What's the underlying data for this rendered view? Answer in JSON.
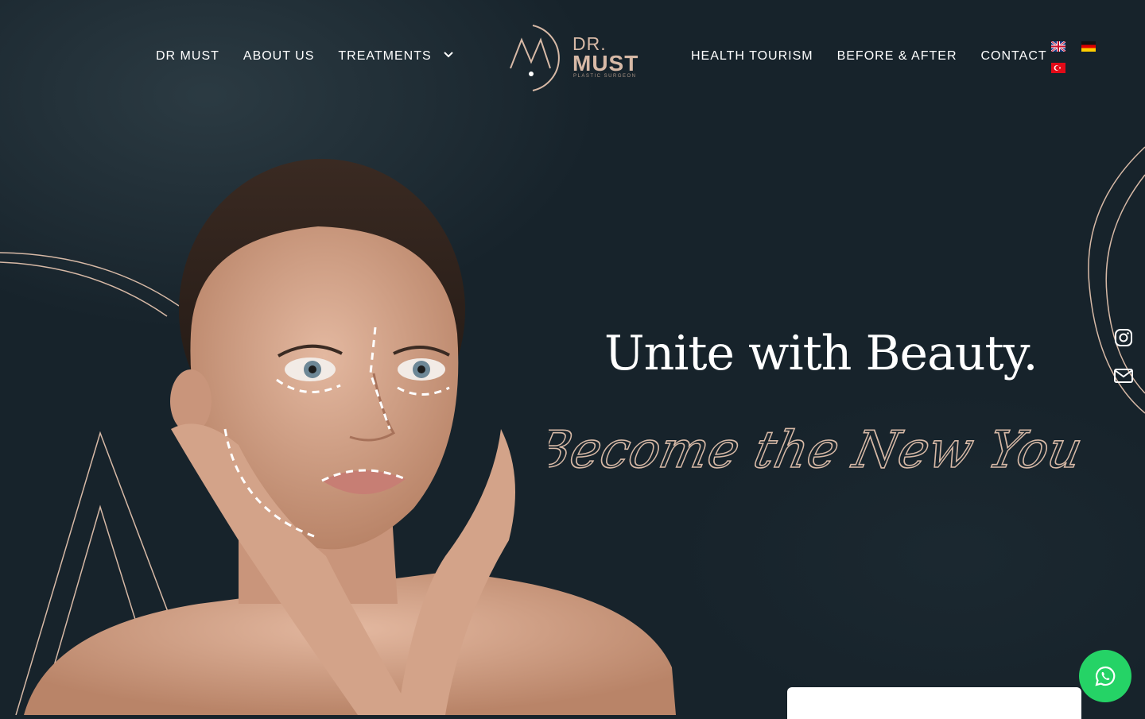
{
  "brand": {
    "logo_dr": "DR.",
    "logo_must": "MUST",
    "logo_sub": "PLASTIC SURGEON",
    "accent": "#d7b9a6",
    "background": "#17232b"
  },
  "nav": {
    "left": [
      {
        "label": "DR MUST"
      },
      {
        "label": "ABOUT US"
      },
      {
        "label": "TREATMENTS",
        "has_dropdown": true
      }
    ],
    "right": [
      {
        "label": "HEALTH TOURISM"
      },
      {
        "label": "BEFORE & AFTER"
      },
      {
        "label": "CONTACT"
      }
    ]
  },
  "languages": [
    {
      "code": "en",
      "icon": "uk-flag-icon"
    },
    {
      "code": "de",
      "icon": "germany-flag-icon"
    },
    {
      "code": "tr",
      "icon": "turkey-flag-icon"
    }
  ],
  "hero": {
    "headline": "Unite with Beauty.",
    "script": "Become the New You"
  },
  "social": [
    {
      "icon": "instagram-icon"
    },
    {
      "icon": "mail-icon"
    }
  ],
  "whatsapp": {
    "icon": "whatsapp-icon",
    "color": "#25d366"
  }
}
